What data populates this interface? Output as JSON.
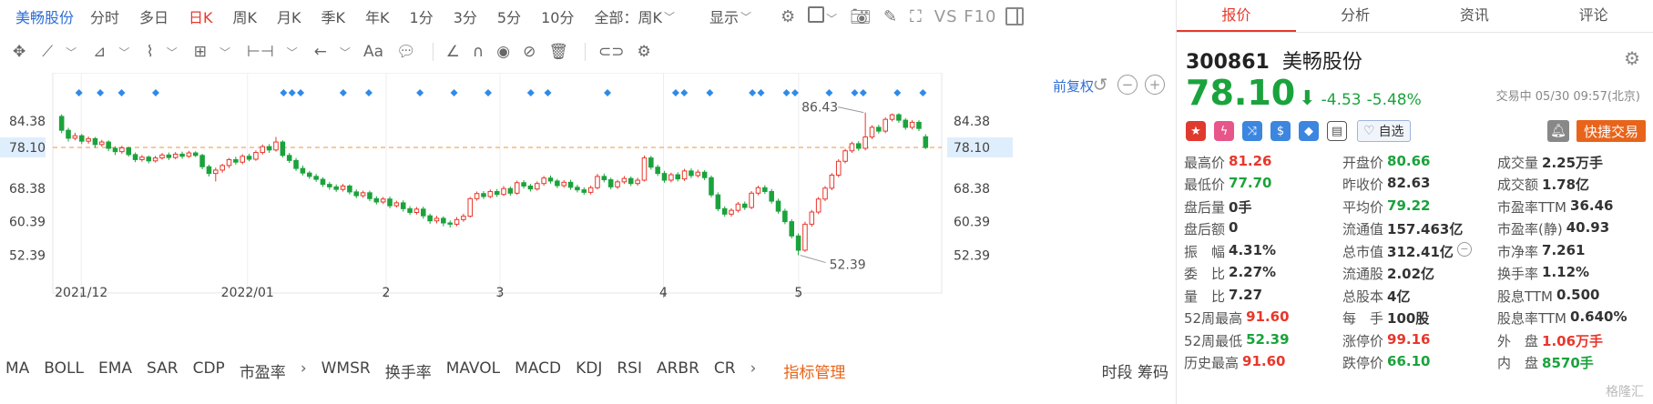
{
  "header": {
    "stock_name": "美畅股份",
    "periods": [
      "分时",
      "多日",
      "日K",
      "周K",
      "月K",
      "季K",
      "年K",
      "1分",
      "3分",
      "5分",
      "10分"
    ],
    "active_period": "日K",
    "range_select": "全部：周K",
    "display_label": "显示",
    "vs_label": "VS F10"
  },
  "chart": {
    "fuquan_label": "前复权",
    "y_ticks": [
      "84.38",
      "78.10",
      "68.38",
      "60.39",
      "52.39"
    ],
    "x_ticks": [
      "2021/12",
      "2022/01",
      "2",
      "3",
      "4",
      "5"
    ],
    "high_label": "86.43",
    "low_label": "52.39",
    "current_price_label": "78.10"
  },
  "indicators": [
    "MA",
    "BOLL",
    "EMA",
    "SAR",
    "CDP",
    "市盈率",
    "WMSR",
    "换手率",
    "MAVOL",
    "MACD",
    "KDJ",
    "RSI",
    "ARBR",
    "CR"
  ],
  "indicator_manager": "指标管理",
  "indicator_right": "时段 筹码",
  "quote": {
    "tabs": [
      "报价",
      "分析",
      "资讯",
      "评论"
    ],
    "active_tab": "报价",
    "code": "300861",
    "name": "美畅股份",
    "price": "78.10",
    "change": "-4.53",
    "change_pct": "-5.48%",
    "status": "交易中 05/30 09:57(北京)",
    "watch_label": "自选",
    "trade_label": "快捷交易",
    "stats": [
      [
        {
          "label": "最高价",
          "value": "81.26",
          "color": "red"
        },
        {
          "label": "开盘价",
          "value": "80.66",
          "color": "green"
        },
        {
          "label": "成交量",
          "value": "2.25万手",
          "color": ""
        }
      ],
      [
        {
          "label": "最低价",
          "value": "77.70",
          "color": "green"
        },
        {
          "label": "昨收价",
          "value": "82.63",
          "color": ""
        },
        {
          "label": "成交额",
          "value": "1.78亿",
          "color": ""
        }
      ],
      [
        {
          "label": "盘后量",
          "value": "0手",
          "color": ""
        },
        {
          "label": "平均价",
          "value": "79.22",
          "color": "green"
        },
        {
          "label": "市盈率TTM",
          "value": "36.46",
          "color": ""
        }
      ],
      [
        {
          "label": "盘后额",
          "value": "0",
          "color": ""
        },
        {
          "label": "流通值",
          "value": "157.463亿",
          "color": ""
        },
        {
          "label": "市盈率(静)",
          "value": "40.93",
          "color": ""
        }
      ],
      [
        {
          "label": "振　幅",
          "value": "4.31%",
          "color": ""
        },
        {
          "label": "总市值",
          "value": "312.41亿",
          "color": ""
        },
        {
          "label": "市净率",
          "value": "7.261",
          "color": ""
        }
      ],
      [
        {
          "label": "委　比",
          "value": "2.27%",
          "color": ""
        },
        {
          "label": "流通股",
          "value": "2.02亿",
          "color": ""
        },
        {
          "label": "换手率",
          "value": "1.12%",
          "color": ""
        }
      ],
      [
        {
          "label": "量　比",
          "value": "7.27",
          "color": ""
        },
        {
          "label": "总股本",
          "value": "4亿",
          "color": ""
        },
        {
          "label": "股息TTM",
          "value": "0.500",
          "color": ""
        }
      ],
      [
        {
          "label": "52周最高",
          "value": "91.60",
          "color": "red"
        },
        {
          "label": "每　手",
          "value": "100股",
          "color": ""
        },
        {
          "label": "股息率TTM",
          "value": "0.640%",
          "color": ""
        }
      ],
      [
        {
          "label": "52周最低",
          "value": "52.39",
          "color": "green"
        },
        {
          "label": "涨停价",
          "value": "99.16",
          "color": "red"
        },
        {
          "label": "外　盘",
          "value": "1.06万手",
          "color": "red"
        }
      ],
      [
        {
          "label": "历史最高",
          "value": "91.60",
          "color": "red"
        },
        {
          "label": "跌停价",
          "value": "66.10",
          "color": "green"
        },
        {
          "label": "内　盘",
          "value": "8570手",
          "color": "green"
        }
      ]
    ],
    "watermark": "格隆汇"
  },
  "colors": {
    "up": "#e8372b",
    "down": "#1aa33c",
    "accent": "#2f6fd6",
    "orange": "#e8641b"
  },
  "chart_data": {
    "type": "candlestick",
    "x_ticks": [
      "2021/12",
      "2022/01",
      "2",
      "3",
      "4",
      "5"
    ],
    "y_ticks": [
      84.38,
      78.1,
      68.38,
      60.39,
      52.39
    ],
    "ylim": [
      46,
      92
    ],
    "high": 86.43,
    "low": 52.39,
    "last": 78.1,
    "candles": [
      [
        85.5,
        82.2,
        86.0,
        81.5
      ],
      [
        82.2,
        80.3,
        82.8,
        79.5
      ],
      [
        80.3,
        80.9,
        81.6,
        79.8
      ],
      [
        80.9,
        79.6,
        81.3,
        78.9
      ],
      [
        79.6,
        80.2,
        80.7,
        79.0
      ],
      [
        80.2,
        78.8,
        80.6,
        78.0
      ],
      [
        78.8,
        79.4,
        79.9,
        78.3
      ],
      [
        79.4,
        77.9,
        79.8,
        77.2
      ],
      [
        77.9,
        77.1,
        78.4,
        76.3
      ],
      [
        77.1,
        78.0,
        78.5,
        76.6
      ],
      [
        78.0,
        76.4,
        78.3,
        75.9
      ],
      [
        76.4,
        75.2,
        76.9,
        74.6
      ],
      [
        75.2,
        75.8,
        76.3,
        74.7
      ],
      [
        75.8,
        74.9,
        76.2,
        74.3
      ],
      [
        74.9,
        75.6,
        76.1,
        74.5
      ],
      [
        75.6,
        76.3,
        76.8,
        75.2
      ],
      [
        76.3,
        75.7,
        76.9,
        75.1
      ],
      [
        75.7,
        76.5,
        77.0,
        75.3
      ],
      [
        76.5,
        76.0,
        77.1,
        75.4
      ],
      [
        76.0,
        76.8,
        77.3,
        75.6
      ],
      [
        76.8,
        76.2,
        77.2,
        75.8
      ],
      [
        76.2,
        73.5,
        76.6,
        72.9
      ],
      [
        73.5,
        71.9,
        74.0,
        71.2
      ],
      [
        71.9,
        72.7,
        73.3,
        70.0
      ],
      [
        72.7,
        73.8,
        74.2,
        72.1
      ],
      [
        73.8,
        75.2,
        75.6,
        73.2
      ],
      [
        75.2,
        74.6,
        75.9,
        74.0
      ],
      [
        74.6,
        76.0,
        76.5,
        74.1
      ],
      [
        76.0,
        75.3,
        76.6,
        74.8
      ],
      [
        75.3,
        76.9,
        77.4,
        74.9
      ],
      [
        76.9,
        78.3,
        78.8,
        76.4
      ],
      [
        78.3,
        77.5,
        78.9,
        76.8
      ],
      [
        77.5,
        79.4,
        80.6,
        77.1
      ],
      [
        79.4,
        76.2,
        79.8,
        75.7
      ],
      [
        76.2,
        75.0,
        76.8,
        74.4
      ],
      [
        75.0,
        73.1,
        75.6,
        72.5
      ],
      [
        73.1,
        72.0,
        73.8,
        71.4
      ],
      [
        72.0,
        71.2,
        72.5,
        70.6
      ],
      [
        71.2,
        70.5,
        71.8,
        69.9
      ],
      [
        70.5,
        69.3,
        71.0,
        68.7
      ],
      [
        69.3,
        68.7,
        69.9,
        68.0
      ],
      [
        68.7,
        68.1,
        69.3,
        67.5
      ],
      [
        68.1,
        68.9,
        69.4,
        67.6
      ],
      [
        68.9,
        67.5,
        69.3,
        66.9
      ],
      [
        67.5,
        66.6,
        68.1,
        66.0
      ],
      [
        66.6,
        67.3,
        67.8,
        66.1
      ],
      [
        67.3,
        65.9,
        67.8,
        65.3
      ],
      [
        65.9,
        65.1,
        66.5,
        64.5
      ],
      [
        65.1,
        65.8,
        66.3,
        64.6
      ],
      [
        65.8,
        64.2,
        66.4,
        63.6
      ],
      [
        64.2,
        64.9,
        65.4,
        63.8
      ],
      [
        64.9,
        63.5,
        65.5,
        62.8
      ],
      [
        63.5,
        62.6,
        64.1,
        62.0
      ],
      [
        62.6,
        63.4,
        63.9,
        62.1
      ],
      [
        63.4,
        61.8,
        64.0,
        61.1
      ],
      [
        61.8,
        60.6,
        62.3,
        59.9
      ],
      [
        60.6,
        61.2,
        61.8,
        60.0
      ],
      [
        61.2,
        60.1,
        61.7,
        59.3
      ],
      [
        60.1,
        59.8,
        60.7,
        59.0
      ],
      [
        59.8,
        60.9,
        61.5,
        59.3
      ],
      [
        60.9,
        61.7,
        62.3,
        60.4
      ],
      [
        61.7,
        65.9,
        66.3,
        61.4
      ],
      [
        65.9,
        67.1,
        67.6,
        65.4
      ],
      [
        67.1,
        66.4,
        67.7,
        65.8
      ],
      [
        66.4,
        67.6,
        68.1,
        66.0
      ],
      [
        67.6,
        66.9,
        68.2,
        66.3
      ],
      [
        66.9,
        68.3,
        68.9,
        66.5
      ],
      [
        68.3,
        67.2,
        68.8,
        66.6
      ],
      [
        67.2,
        69.7,
        70.2,
        66.8
      ],
      [
        69.7,
        68.9,
        70.3,
        68.3
      ],
      [
        68.9,
        68.2,
        69.4,
        67.6
      ],
      [
        68.2,
        69.5,
        70.0,
        67.8
      ],
      [
        69.5,
        70.8,
        71.3,
        69.0
      ],
      [
        70.8,
        70.1,
        71.4,
        69.5
      ],
      [
        70.1,
        69.0,
        70.6,
        68.4
      ],
      [
        69.0,
        69.8,
        70.3,
        68.5
      ],
      [
        69.8,
        68.6,
        70.4,
        68.0
      ],
      [
        68.6,
        68.0,
        69.2,
        67.4
      ],
      [
        68.0,
        67.4,
        68.6,
        66.8
      ],
      [
        67.4,
        68.5,
        69.0,
        66.9
      ],
      [
        68.5,
        71.2,
        71.8,
        68.1
      ],
      [
        71.2,
        70.4,
        71.9,
        69.8
      ],
      [
        70.4,
        68.7,
        70.9,
        68.1
      ],
      [
        68.7,
        69.9,
        70.4,
        68.2
      ],
      [
        69.9,
        70.7,
        71.3,
        69.4
      ],
      [
        70.7,
        69.5,
        71.2,
        68.9
      ],
      [
        69.5,
        70.3,
        70.9,
        69.0
      ],
      [
        70.3,
        75.6,
        76.2,
        70.0
      ],
      [
        75.6,
        73.4,
        76.1,
        72.8
      ],
      [
        73.4,
        71.9,
        74.0,
        71.3
      ],
      [
        71.9,
        70.3,
        72.5,
        69.7
      ],
      [
        70.3,
        71.6,
        72.1,
        69.8
      ],
      [
        71.6,
        70.6,
        72.2,
        70.0
      ],
      [
        70.6,
        72.5,
        73.0,
        70.1
      ],
      [
        72.5,
        71.4,
        73.1,
        70.8
      ],
      [
        71.4,
        72.2,
        72.8,
        70.9
      ],
      [
        72.2,
        70.9,
        72.7,
        70.3
      ],
      [
        70.9,
        66.8,
        71.4,
        66.2
      ],
      [
        66.8,
        63.5,
        67.4,
        62.9
      ],
      [
        63.5,
        62.2,
        64.1,
        61.6
      ],
      [
        62.2,
        63.1,
        63.6,
        61.6
      ],
      [
        63.1,
        64.6,
        65.1,
        62.6
      ],
      [
        64.6,
        63.8,
        65.2,
        63.2
      ],
      [
        63.8,
        67.2,
        67.7,
        63.4
      ],
      [
        67.2,
        68.5,
        69.0,
        66.7
      ],
      [
        68.5,
        67.6,
        69.1,
        67.0
      ],
      [
        67.6,
        65.3,
        68.2,
        64.7
      ],
      [
        65.3,
        62.9,
        65.9,
        62.3
      ],
      [
        62.9,
        60.4,
        63.5,
        59.8
      ],
      [
        60.4,
        57.0,
        61.0,
        56.4
      ],
      [
        57.0,
        53.6,
        57.6,
        52.39
      ],
      [
        53.6,
        59.8,
        60.4,
        53.2
      ],
      [
        59.8,
        62.7,
        63.2,
        59.2
      ],
      [
        62.7,
        65.8,
        66.3,
        62.2
      ],
      [
        65.8,
        68.4,
        68.9,
        65.3
      ],
      [
        68.4,
        71.5,
        72.0,
        67.9
      ],
      [
        71.5,
        74.8,
        75.3,
        71.0
      ],
      [
        74.8,
        77.3,
        77.8,
        74.3
      ],
      [
        77.3,
        79.0,
        79.5,
        76.8
      ],
      [
        79.0,
        77.9,
        79.6,
        77.3
      ],
      [
        77.9,
        80.6,
        86.43,
        77.4
      ],
      [
        80.6,
        82.9,
        83.4,
        80.1
      ],
      [
        82.9,
        82.0,
        83.5,
        81.4
      ],
      [
        82.0,
        84.8,
        85.3,
        81.5
      ],
      [
        84.8,
        85.9,
        86.2,
        84.3
      ],
      [
        85.9,
        84.6,
        86.3,
        84.0
      ],
      [
        84.6,
        82.9,
        85.1,
        82.3
      ],
      [
        82.9,
        84.1,
        84.6,
        82.4
      ],
      [
        84.1,
        82.63,
        84.6,
        82.0
      ],
      [
        80.66,
        78.1,
        81.26,
        77.7
      ]
    ],
    "marker_positions": [
      0.02,
      0.045,
      0.07,
      0.11,
      0.26,
      0.27,
      0.28,
      0.33,
      0.36,
      0.42,
      0.46,
      0.5,
      0.55,
      0.57,
      0.64,
      0.72,
      0.73,
      0.76,
      0.81,
      0.82,
      0.85,
      0.86,
      0.9,
      0.93,
      0.94,
      0.98,
      1.01
    ]
  }
}
